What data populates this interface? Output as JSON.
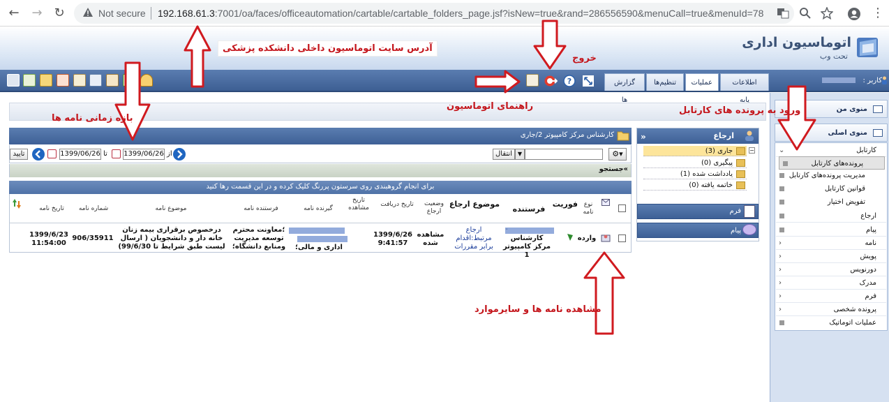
{
  "browser": {
    "not_secure": "Not secure",
    "url_host": "192.168.61.3",
    "url_rest": ":7001/oa/faces/officeautomation/cartable/cartable_folders_page.jsf?isNew=true&rand=286556590&menuCall=true&menuId=78"
  },
  "app": {
    "title": "اتوماسیون اداری",
    "subtitle": "تحت وب"
  },
  "tabs": [
    "اطلاعات پایه",
    "عملیات",
    "تنظیم‌ها",
    "گزارش ها"
  ],
  "user_label": "کاربر :",
  "sidebar": {
    "personal_menu": "منوی من",
    "main_menu": "منوی اصلی",
    "items": [
      {
        "label": "کارتابل",
        "kind": "group-open"
      },
      {
        "label": "پرونده‌های کارتابل",
        "kind": "sub-selected"
      },
      {
        "label": "مدیریت پرونده‌های کارتابل",
        "kind": "sub"
      },
      {
        "label": "قوانین کارتابل",
        "kind": "sub"
      },
      {
        "label": "تفویض اختیار",
        "kind": "sub"
      },
      {
        "label": "ارجاع",
        "kind": "leaf"
      },
      {
        "label": "پیام",
        "kind": "leaf"
      },
      {
        "label": "نامه",
        "kind": "group"
      },
      {
        "label": "پویش",
        "kind": "group"
      },
      {
        "label": "دورنویس",
        "kind": "group"
      },
      {
        "label": "مدرک",
        "kind": "group"
      },
      {
        "label": "فرم",
        "kind": "group"
      },
      {
        "label": "پرونده شخصی",
        "kind": "group"
      },
      {
        "label": "عملیات اتوماتیک",
        "kind": "leaf"
      }
    ]
  },
  "main": {
    "header": "کارشناس مرکز کامپیوتر 2/جاری",
    "filter": {
      "from_label": "از",
      "to_label": "تا",
      "from_date": "1399/06/26",
      "to_date": "1399/06/26",
      "confirm": "تایید",
      "move": "انتقال"
    },
    "search": "»جستجو",
    "group_hint": "برای انجام گروهبندی روی سرستون پررنگ کلیک کرده و در این قسمت رها کنید",
    "columns": {
      "type": "نوع نامه",
      "urgency": "فوریت",
      "sender": "فرستنده",
      "subject_ref": "موضوع ارجاع",
      "ref_status": "وضعیت ارجاع",
      "receive_date": "تاریخ دریافت",
      "view_date": "تاریخ مشاهده",
      "receiver": "گیرنده نامه",
      "letter_sender": "فرستنده نامه",
      "letter_subject": "موضوع نامه",
      "letter_number": "شماره نامه",
      "letter_date": "تاریخ نامه"
    },
    "row": {
      "type": "وارده",
      "sender": "کارشناس مرکز کامپیوتر 1",
      "sender_prefix": "-",
      "subject_ref": "ارجاع مرتبط:اقدام برابر مقررات",
      "ref_status": "مشاهده شده",
      "receive_date": "1399/6/26",
      "receive_time": "9:41:57",
      "receiver": "اداری و مالی؛",
      "letter_sender": "؛معاونت محترم توسعه مدیریت ومنابع دانشگاه؛",
      "letter_subject": "درخصوص برقراری بیمه زنان خانه دار و دانشجویان ( ارسال لیست طبق شرایط تا 99/6/30)",
      "letter_number": "906/35911",
      "letter_date": "1399/6/23",
      "letter_time": "11:54:00"
    }
  },
  "tree": {
    "title": "ارجاع",
    "items": [
      {
        "label": "جاری",
        "count": "(3)"
      },
      {
        "label": "پیگیری",
        "count": "(0)"
      },
      {
        "label": "یادداشت شده",
        "count": "(1)"
      },
      {
        "label": "خاتمه یافته",
        "count": "(0)"
      }
    ],
    "form": "فرم",
    "message": "پیام"
  },
  "annotations": {
    "site_address": "آدرس سایت اتوماسیون داخلی دانشکده پزشکی",
    "exit": "خروج",
    "guide": "راهنمای اتوماسیون",
    "cartable": "ورود به پرونده های کارتابل",
    "timespan": "بازه زمانی نامه ها",
    "view_letters": "مشاهده نامه ها و سایرموارد"
  },
  "colors": {
    "annotation_red": "#c4161c",
    "toolbar_blue": "#4a6da3",
    "highlight": "#fde59b"
  }
}
